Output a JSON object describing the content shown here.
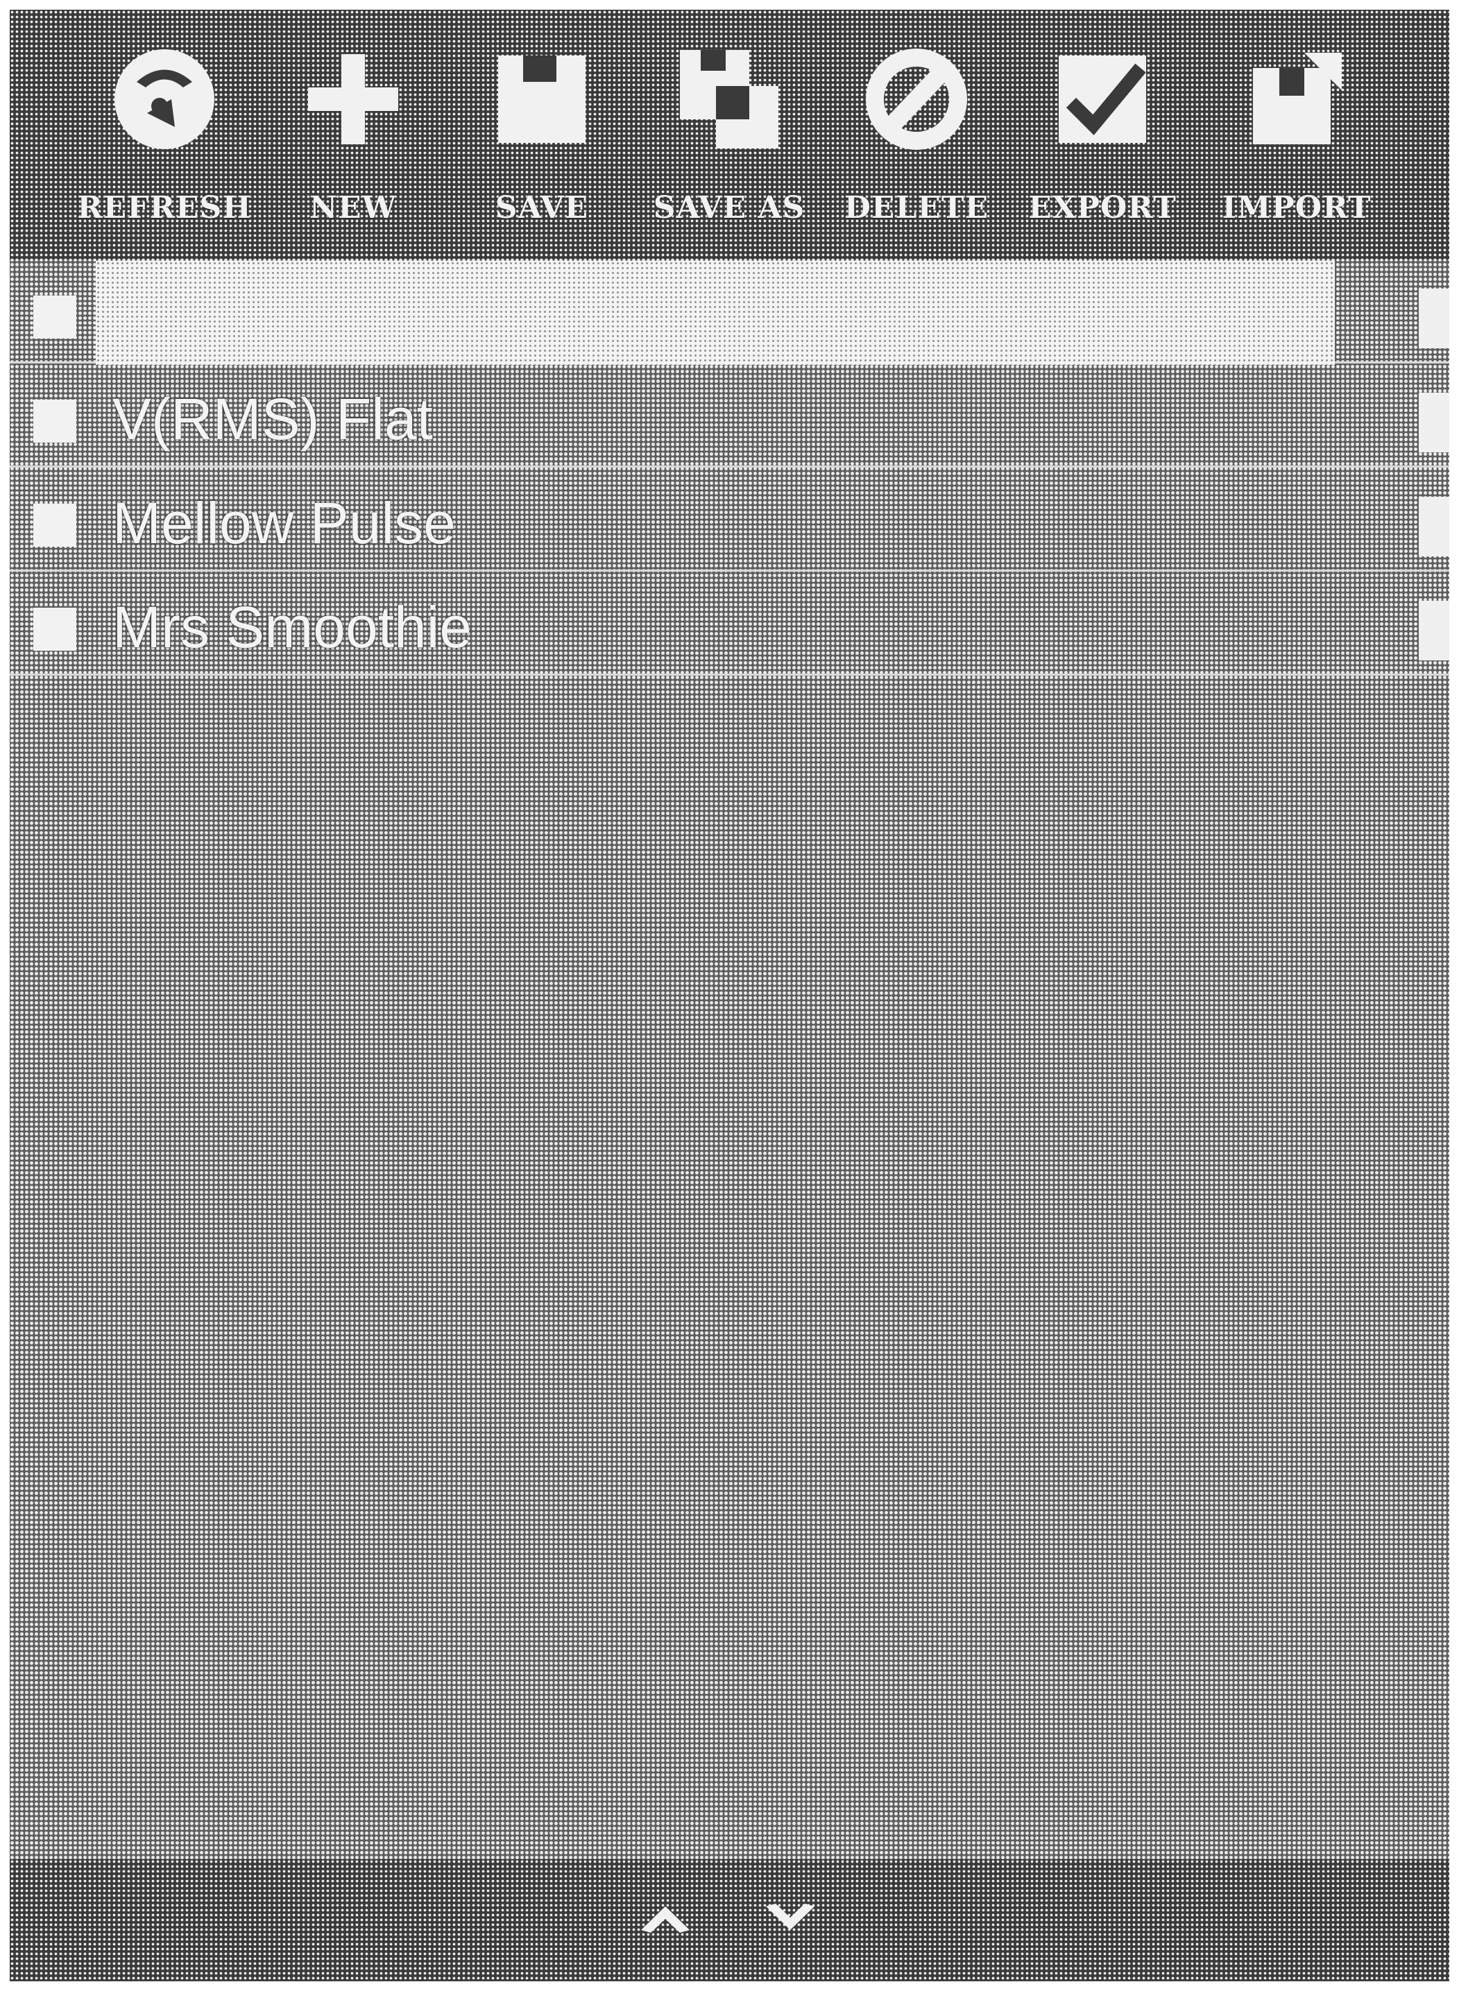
{
  "toolbar": {
    "buttons": [
      {
        "id": "refresh",
        "label": "REFRESH",
        "icon": "refresh-icon"
      },
      {
        "id": "new",
        "label": "NEW",
        "icon": "plus-icon"
      },
      {
        "id": "save",
        "label": "SAVE",
        "icon": "floppy-disk-icon"
      },
      {
        "id": "save_as",
        "label": "SAVE AS",
        "icon": "save-as-icon"
      },
      {
        "id": "delete",
        "label": "DELETE",
        "icon": "prohibited-icon"
      },
      {
        "id": "export",
        "label": "EXPORT",
        "icon": "export-check-icon"
      },
      {
        "id": "import",
        "label": "IMPORT",
        "icon": "import-icon"
      }
    ]
  },
  "list": {
    "selected_value": "",
    "items": [
      {
        "name": "V(RMS) Flat"
      },
      {
        "name": "Mellow Pulse"
      },
      {
        "name": "Mrs Smoothie"
      }
    ]
  },
  "bottombar": {
    "up_icon": "chevron-up-icon",
    "down_icon": "chevron-down-icon"
  }
}
